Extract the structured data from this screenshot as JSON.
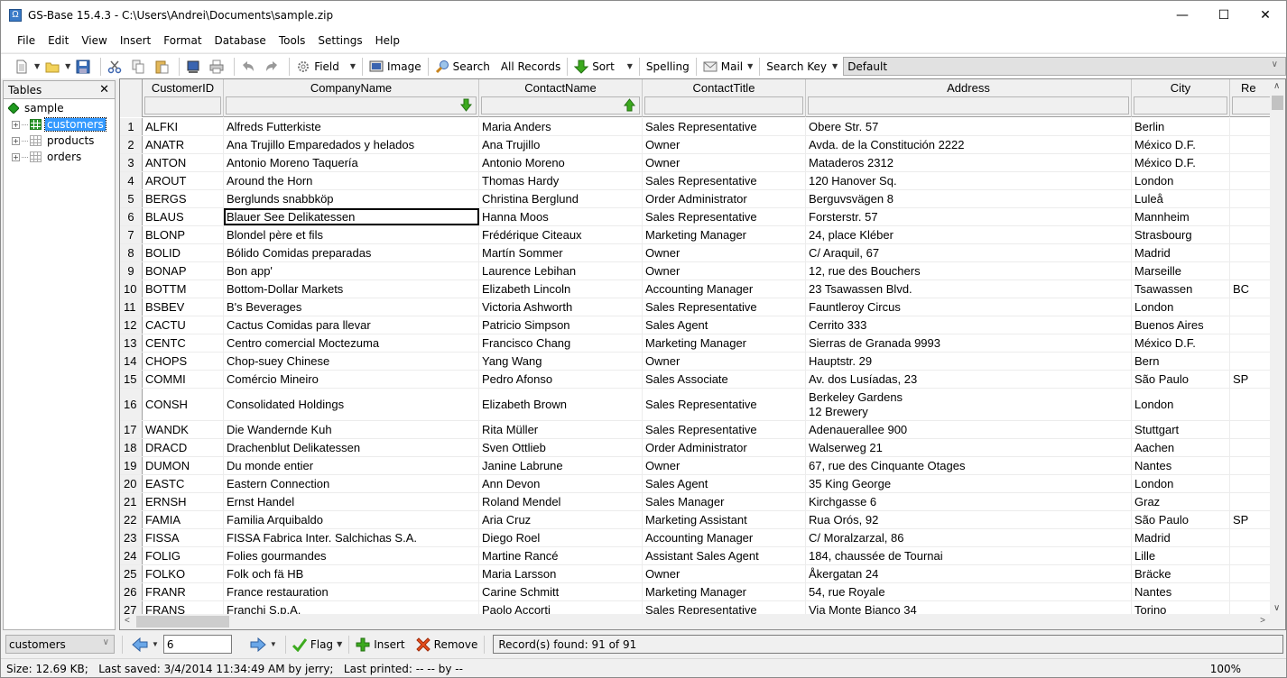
{
  "window": {
    "title": "GS-Base 15.4.3 - C:\\Users\\Andrei\\Documents\\sample.zip",
    "app_icon": "omega-icon",
    "controls": {
      "minimize": "—",
      "maximize": "☐",
      "close": "✕"
    }
  },
  "menu": [
    "File",
    "Edit",
    "View",
    "Insert",
    "Format",
    "Database",
    "Tools",
    "Settings",
    "Help"
  ],
  "toolbar": {
    "field": "Field",
    "image": "Image",
    "search": "Search",
    "all_records": "All Records",
    "sort": "Sort",
    "spelling": "Spelling",
    "mail": "Mail",
    "search_key": "Search Key",
    "search_key_value": "Default"
  },
  "tables_panel": {
    "title": "Tables",
    "close": "✕",
    "root": "sample",
    "tables": [
      "customers",
      "products",
      "orders"
    ],
    "selected": "customers"
  },
  "grid": {
    "columns": [
      "CustomerID",
      "CompanyName",
      "ContactName",
      "ContactTitle",
      "Address",
      "City",
      "Region"
    ],
    "header_visible_labels": [
      "CustomerID",
      "CompanyName",
      "ContactName",
      "ContactTitle",
      "Address",
      "City",
      "Re"
    ],
    "sort": {
      "CompanyName": "descending",
      "ContactName": "ascending"
    },
    "current_row": 6,
    "current_column": "CompanyName",
    "rows": [
      [
        "1",
        "ALFKI",
        "Alfreds Futterkiste",
        "Maria Anders",
        "Sales Representative",
        "Obere Str. 57",
        "Berlin",
        ""
      ],
      [
        "2",
        "ANATR",
        "Ana Trujillo Emparedados y helados",
        "Ana Trujillo",
        "Owner",
        "Avda. de la Constitución 2222",
        "México D.F.",
        ""
      ],
      [
        "3",
        "ANTON",
        "Antonio Moreno Taquería",
        "Antonio Moreno",
        "Owner",
        "Mataderos 2312",
        "México D.F.",
        ""
      ],
      [
        "4",
        "AROUT",
        "Around the Horn",
        "Thomas Hardy",
        "Sales Representative",
        "120 Hanover Sq.",
        "London",
        ""
      ],
      [
        "5",
        "BERGS",
        "Berglunds snabbköp",
        "Christina Berglund",
        "Order Administrator",
        "Berguvsvägen 8",
        "Luleå",
        ""
      ],
      [
        "6",
        "BLAUS",
        "Blauer See Delikatessen",
        "Hanna Moos",
        "Sales Representative",
        "Forsterstr. 57",
        "Mannheim",
        ""
      ],
      [
        "7",
        "BLONP",
        "Blondel père et fils",
        "Frédérique Citeaux",
        "Marketing Manager",
        "24, place Kléber",
        "Strasbourg",
        ""
      ],
      [
        "8",
        "BOLID",
        "Bólido Comidas preparadas",
        "Martín Sommer",
        "Owner",
        "C/ Araquil, 67",
        "Madrid",
        ""
      ],
      [
        "9",
        "BONAP",
        "Bon app'",
        "Laurence Lebihan",
        "Owner",
        "12, rue des Bouchers",
        "Marseille",
        ""
      ],
      [
        "10",
        "BOTTM",
        "Bottom-Dollar Markets",
        "Elizabeth Lincoln",
        "Accounting Manager",
        "23 Tsawassen Blvd.",
        "Tsawassen",
        "BC"
      ],
      [
        "11",
        "BSBEV",
        "B's Beverages",
        "Victoria Ashworth",
        "Sales Representative",
        "Fauntleroy Circus",
        "London",
        ""
      ],
      [
        "12",
        "CACTU",
        "Cactus Comidas para llevar",
        "Patricio Simpson",
        "Sales Agent",
        "Cerrito 333",
        "Buenos Aires",
        ""
      ],
      [
        "13",
        "CENTC",
        "Centro comercial Moctezuma",
        "Francisco Chang",
        "Marketing Manager",
        "Sierras de Granada 9993",
        "México D.F.",
        ""
      ],
      [
        "14",
        "CHOPS",
        "Chop-suey Chinese",
        "Yang Wang",
        "Owner",
        "Hauptstr. 29",
        "Bern",
        ""
      ],
      [
        "15",
        "COMMI",
        "Comércio Mineiro",
        "Pedro Afonso",
        "Sales Associate",
        "Av. dos Lusíadas, 23",
        "São Paulo",
        "SP"
      ],
      [
        "16",
        "CONSH",
        "Consolidated Holdings",
        "Elizabeth Brown",
        "Sales Representative",
        "Berkeley Gardens\n12 Brewery",
        "London",
        ""
      ],
      [
        "17",
        "WANDK",
        "Die Wandernde Kuh",
        "Rita Müller",
        "Sales Representative",
        "Adenauerallee 900",
        "Stuttgart",
        ""
      ],
      [
        "18",
        "DRACD",
        "Drachenblut Delikatessen",
        "Sven Ottlieb",
        "Order Administrator",
        "Walserweg 21",
        "Aachen",
        ""
      ],
      [
        "19",
        "DUMON",
        "Du monde entier",
        "Janine Labrune",
        "Owner",
        "67, rue des Cinquante Otages",
        "Nantes",
        ""
      ],
      [
        "20",
        "EASTC",
        "Eastern Connection",
        "Ann Devon",
        "Sales Agent",
        "35 King George",
        "London",
        ""
      ],
      [
        "21",
        "ERNSH",
        "Ernst Handel",
        "Roland Mendel",
        "Sales Manager",
        "Kirchgasse 6",
        "Graz",
        ""
      ],
      [
        "22",
        "FAMIA",
        "Familia Arquibaldo",
        "Aria Cruz",
        "Marketing Assistant",
        "Rua Orós, 92",
        "São Paulo",
        "SP"
      ],
      [
        "23",
        "FISSA",
        "FISSA Fabrica Inter. Salchichas S.A.",
        "Diego Roel",
        "Accounting Manager",
        "C/ Moralzarzal, 86",
        "Madrid",
        ""
      ],
      [
        "24",
        "FOLIG",
        "Folies gourmandes",
        "Martine Rancé",
        "Assistant Sales Agent",
        "184, chaussée de Tournai",
        "Lille",
        ""
      ],
      [
        "25",
        "FOLKO",
        "Folk och fä HB",
        "Maria Larsson",
        "Owner",
        "Åkergatan 24",
        "Bräcke",
        ""
      ],
      [
        "26",
        "FRANR",
        "France restauration",
        "Carine Schmitt",
        "Marketing Manager",
        "54, rue Royale",
        "Nantes",
        ""
      ],
      [
        "27",
        "FRANS",
        "Franchi S.p.A.",
        "Paolo Accorti",
        "Sales Representative",
        "Via Monte Bianco 34",
        "Torino",
        ""
      ]
    ]
  },
  "navbar": {
    "table_select": "customers",
    "record_number": "6",
    "flag": "Flag",
    "insert": "Insert",
    "remove": "Remove",
    "records_found": "Record(s) found: 91 of 91"
  },
  "status": {
    "text": "Size: 12.69 KB;   Last saved: 3/4/2014 11:34:49 AM by jerry;   Last printed: -- -- by --",
    "zoom": "100%"
  },
  "colors": {
    "selection": "#3399ff",
    "sort_arrow": "#3caa1e",
    "accent": "#3a7bc8"
  }
}
